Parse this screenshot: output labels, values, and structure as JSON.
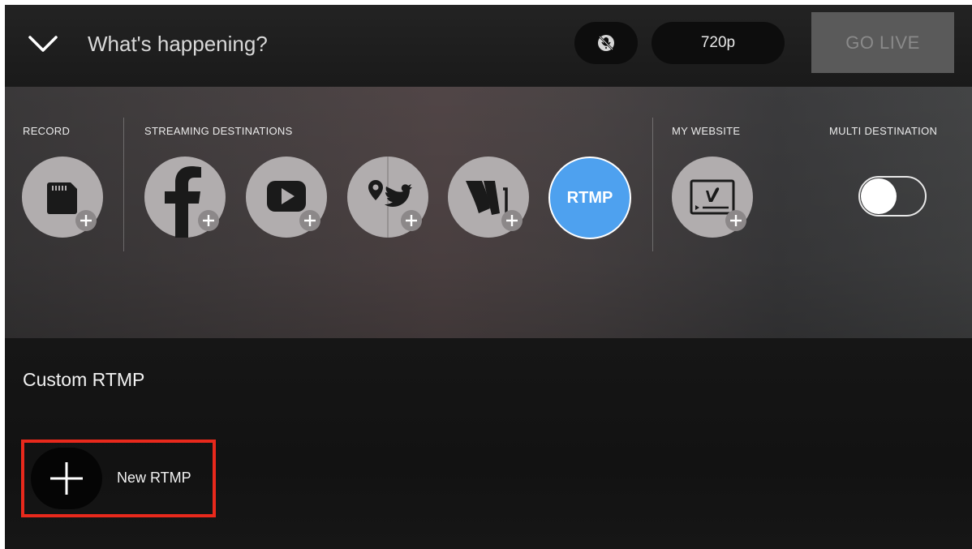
{
  "header": {
    "title_placeholder": "What's happening?",
    "resolution": "720p",
    "go_live_label": "GO LIVE",
    "collapse_icon": "chevron-down-icon",
    "mic_icon": "mic-off-icon"
  },
  "destinations": {
    "sections": {
      "record": "RECORD",
      "streaming": "STREAMING DESTINATIONS",
      "website": "MY WEBSITE",
      "multi": "MULTI DESTINATION"
    },
    "items": [
      {
        "id": "sd-card",
        "icon": "sd-card-icon",
        "selected": false
      },
      {
        "id": "facebook",
        "icon": "facebook-icon",
        "selected": false
      },
      {
        "id": "youtube",
        "icon": "youtube-icon",
        "selected": false
      },
      {
        "id": "periscope-twitter",
        "icon": "periscope-twitter-icon",
        "selected": false
      },
      {
        "id": "ustream",
        "icon": "ustream-icon",
        "selected": false
      },
      {
        "id": "rtmp",
        "label": "RTMP",
        "selected": true
      },
      {
        "id": "vimeo",
        "icon": "vimeo-icon",
        "selected": false
      }
    ],
    "multi_destination_enabled": false
  },
  "custom_rtmp": {
    "title": "Custom RTMP",
    "new_label": "New RTMP"
  },
  "colors": {
    "rtmp_selected": "#4ea1ef",
    "highlight_box": "#e8291c"
  }
}
